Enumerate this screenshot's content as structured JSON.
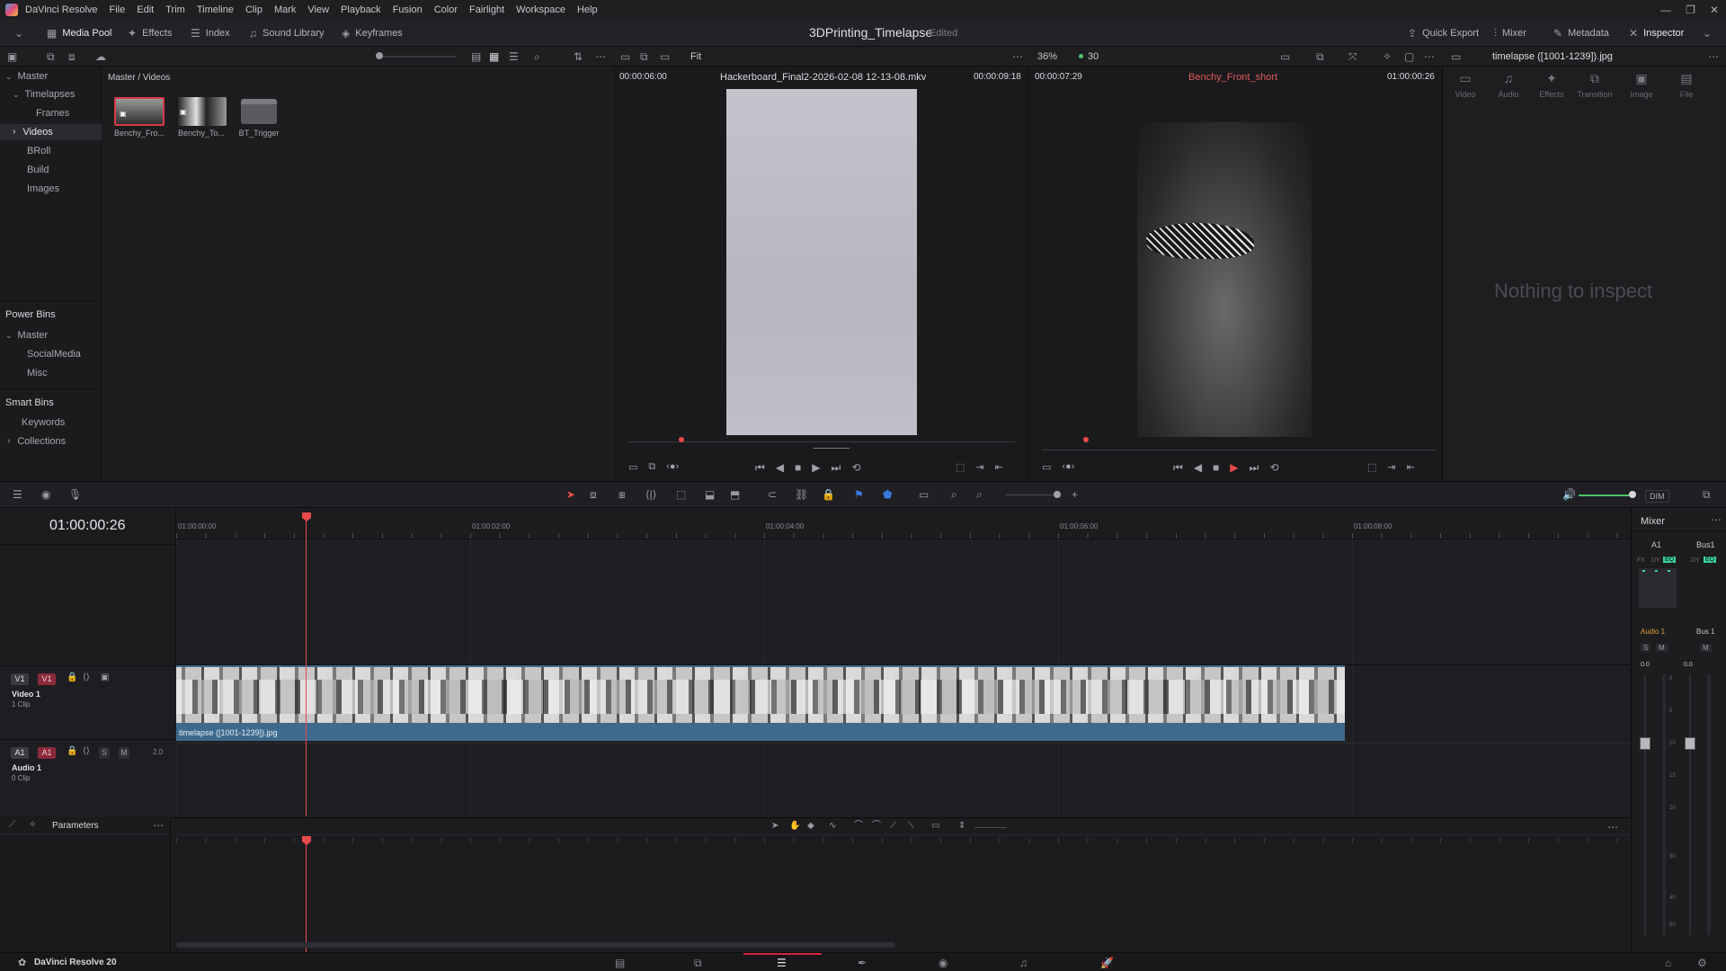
{
  "menubar": {
    "app_name": "DaVinci Resolve",
    "items": [
      "File",
      "Edit",
      "Trim",
      "Timeline",
      "Clip",
      "Mark",
      "View",
      "Playback",
      "Fusion",
      "Color",
      "Fairlight",
      "Workspace",
      "Help"
    ]
  },
  "toolbar": {
    "media_pool": "Media Pool",
    "effects": "Effects",
    "index": "Index",
    "sound_library": "Sound Library",
    "keyframes": "Keyframes",
    "project_title": "3DPrinting_Timelapse",
    "project_status": "Edited",
    "quick_export": "Quick Export",
    "mixer": "Mixer",
    "metadata": "Metadata",
    "inspector": "Inspector"
  },
  "subbar": {
    "fit": "Fit",
    "zoom": "36%",
    "fps": "30",
    "inspector_clip": "timelapse ([1001-1239]).jpg"
  },
  "bins": {
    "master": "Master",
    "timelapses": "Timelapses",
    "frames": "Frames",
    "videos": "Videos",
    "broll": "BRoll",
    "build": "Build",
    "images": "Images",
    "power_bins_title": "Power Bins",
    "power_master": "Master",
    "social_media": "SocialMedia",
    "misc": "Misc",
    "smart_bins_title": "Smart Bins",
    "keywords": "Keywords",
    "collections": "Collections"
  },
  "mediapool": {
    "path": "Master / Videos",
    "clips": [
      {
        "label": "Benchy_Fro..."
      },
      {
        "label": "Benchy_To..."
      },
      {
        "label": "BT_Trigger"
      }
    ]
  },
  "source_viewer": {
    "timecode_left": "00:00:06:00",
    "clip_name": "Hackerboard_Final2-2026-02-08 12-13-08.mkv",
    "timecode_right": "00:00:09:18"
  },
  "program_viewer": {
    "timecode_left": "00:00:07:29",
    "clip_name": "Benchy_Front_short",
    "timecode_right": "01:00:00:26"
  },
  "inspector": {
    "tabs": [
      "Video",
      "Audio",
      "Effects",
      "Transition",
      "Image",
      "File"
    ],
    "empty_message": "Nothing to inspect"
  },
  "timeline": {
    "timecode": "01:00:00:26",
    "ruler": [
      "01:00:00:00",
      "01:00:02:00",
      "01:00:04:00",
      "01:00:06:00",
      "01:00:08:00"
    ],
    "video_track": {
      "badge_a": "V1",
      "badge_b": "V1",
      "name": "Video 1",
      "count": "1 Clip"
    },
    "audio_track": {
      "badge_a": "A1",
      "badge_b": "A1",
      "solo": "S",
      "mute": "M",
      "level": "2.0",
      "name": "Audio 1",
      "count": "0 Clip"
    },
    "clip_name": "timelapse ([1001-1239]).jpg",
    "dim": "DIM"
  },
  "mixer": {
    "title": "Mixer",
    "ch1": "A1",
    "ch2": "Bus1",
    "fx": "FX",
    "dy": "DY",
    "eq": "EQ",
    "dy2": "DY",
    "eq2": "EQ",
    "audio1": "Audio 1",
    "bus1": "Bus 1",
    "s": "S",
    "m": "M",
    "m2": "M",
    "level1": "0.0",
    "level2": "0.0",
    "scale": [
      "0",
      "5",
      "10",
      "15",
      "20",
      "30",
      "40",
      "50"
    ]
  },
  "params": {
    "title": "Parameters"
  },
  "pagebar": {
    "brand": "DaVinci Resolve 20"
  },
  "colors": {
    "accent": "#e84a4a",
    "clip_blue": "#3e6a8e",
    "active_page": "#d4243a"
  }
}
